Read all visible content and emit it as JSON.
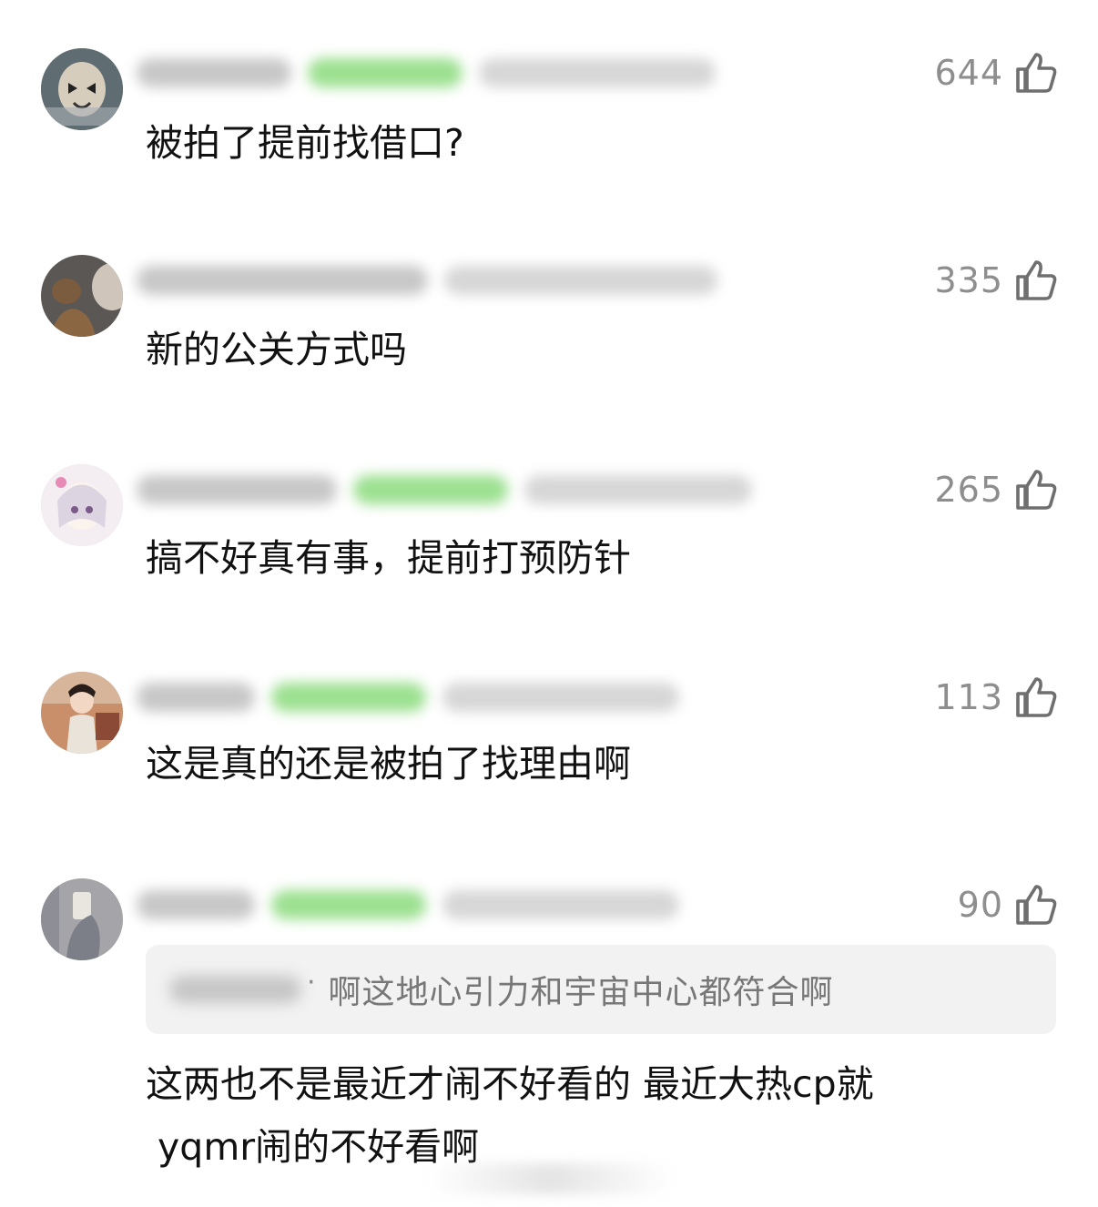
{
  "comments": [
    {
      "likes": "644",
      "text": "被拍了提前找借口?",
      "avatar_color": "#7a8a90"
    },
    {
      "likes": "335",
      "text": "新的公关方式吗",
      "avatar_color": "#6b5a4a"
    },
    {
      "likes": "265",
      "text": "搞不好真有事，提前打预防针",
      "avatar_color": "#e8dde8"
    },
    {
      "likes": "113",
      "text": "这是真的还是被拍了找理由啊",
      "avatar_color": "#9a6a50"
    },
    {
      "likes": "90",
      "text": "这两也不是最近才闹不好看的 最近大热cp就\n yqmr闹的不好看啊",
      "avatar_color": "#9b9ea6",
      "quote": {
        "text": "啊这地心引力和宇宙中心都符合啊"
      }
    }
  ],
  "icons": {
    "like": "thumbs-up-icon"
  },
  "colors": {
    "text": "#111111",
    "meta": "#8e8e8e",
    "badge": "#7bd66b",
    "quote_bg": "#f2f2f2"
  }
}
